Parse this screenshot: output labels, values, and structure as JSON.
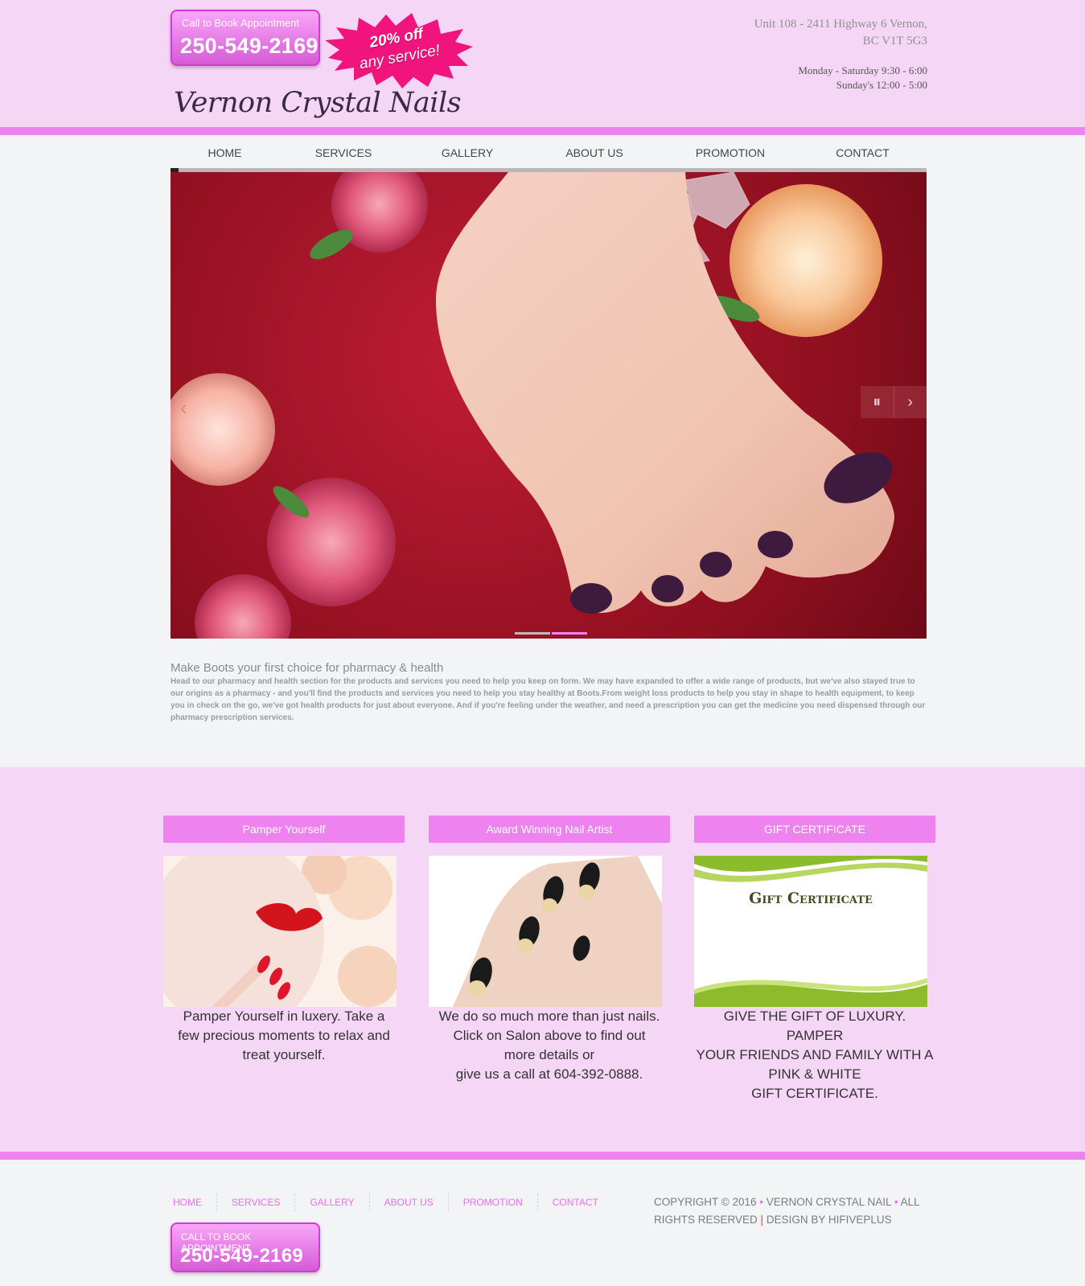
{
  "header": {
    "call_label": "Call to Book Appointment",
    "call_number": "250-549-2169",
    "promo_line1": "20% off",
    "promo_line2": "any service!",
    "logo": "Vernon Crystal Nails",
    "address_line1": "Unit 108 - 2411 Highway 6 Vernon,",
    "address_line2": "BC V1T 5G3",
    "hours_line1": "Monday - Saturday 9:30 - 6:00",
    "hours_line2": "Sunday's 12:00 - 5:00"
  },
  "nav": [
    "HOME",
    "SERVICES",
    "GALLERY",
    "ABOUT US",
    "PROMOTION",
    "CONTACT"
  ],
  "slider": {
    "prev": "‹",
    "pause": "⏸",
    "next": "›",
    "active_dot": 2
  },
  "intro": {
    "title": "Make Boots your first choice for pharmacy & health",
    "text": "Head to our pharmacy and health section for the products and services you need to help you keep on form. We may have expanded to offer a wide range of products, but we've also stayed true to our origins as a pharmacy - and you'll find the products and services you need to help you stay healthy at Boots.From weight loss products to help you stay in shape to health equipment, to keep you in check on the go, we've got health products for just about everyone. And if you're feeling under the weather, and need a prescription you can get the medicine you need dispensed through our pharmacy prescription services."
  },
  "features": [
    {
      "title": "Pamper Yourself",
      "lines": [
        "Pamper Yourself in luxery.  Take a",
        "few precious moments to relax and",
        "treat yourself."
      ]
    },
    {
      "title": "Award Winning Nail Artist",
      "lines": [
        "We do so much more than just nails.",
        "Click on Salon above to find out",
        "more details or",
        "give us a call at 604-392-0888."
      ]
    },
    {
      "title": "GIFT CERTIFICATE",
      "image_text": "Gift Certificate",
      "lines": [
        "GIVE THE GIFT OF LUXURY. PAMPER",
        "YOUR FRIENDS AND FAMILY WITH A",
        "PINK & WHITE",
        "GIFT CERTIFICATE."
      ]
    }
  ],
  "footer": {
    "nav": [
      "HOME",
      "SERVICES",
      "GALLERY",
      "ABOUT US",
      "PROMOTION",
      "CONTACT"
    ],
    "copyright": "COPYRIGHT © 2016",
    "company": "VERNON CRYSTAL NAIL",
    "rights": "ALL RIGHTS RESERVED",
    "design": "DESIGN BY  HIFIVEPLUS",
    "call_label": "CALL TO BOOK APPOINTMENT",
    "call_number": "250-549-2169"
  },
  "colors": {
    "pink_bg": "#f6d6f6",
    "accent": "#ee82ee",
    "promo_star": "#f0147c",
    "page_bg": "#f3f4f6"
  }
}
